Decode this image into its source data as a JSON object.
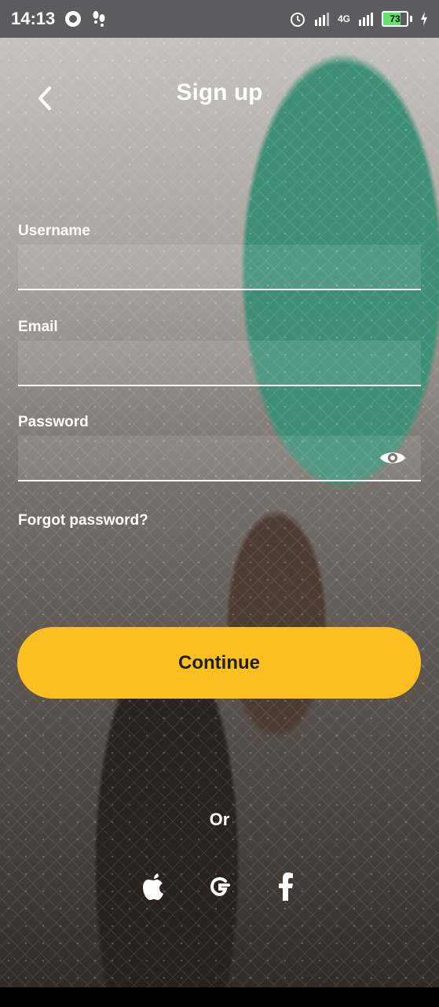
{
  "status_bar": {
    "time": "14:13",
    "network_label": "4G",
    "battery_percent": "73"
  },
  "header": {
    "title": "Sign up",
    "back_icon": "chevron-left-icon"
  },
  "form": {
    "username": {
      "label": "Username",
      "value": "",
      "placeholder": ""
    },
    "email": {
      "label": "Email",
      "value": "",
      "placeholder": ""
    },
    "password": {
      "label": "Password",
      "value": "",
      "placeholder": "",
      "toggle_icon": "eye-icon"
    },
    "forgot_password": "Forgot password?"
  },
  "actions": {
    "continue_label": "Continue",
    "accent_color": "#fbbf22"
  },
  "social": {
    "or_text": "Or",
    "providers": [
      "apple-icon",
      "google-icon",
      "facebook-icon"
    ]
  }
}
